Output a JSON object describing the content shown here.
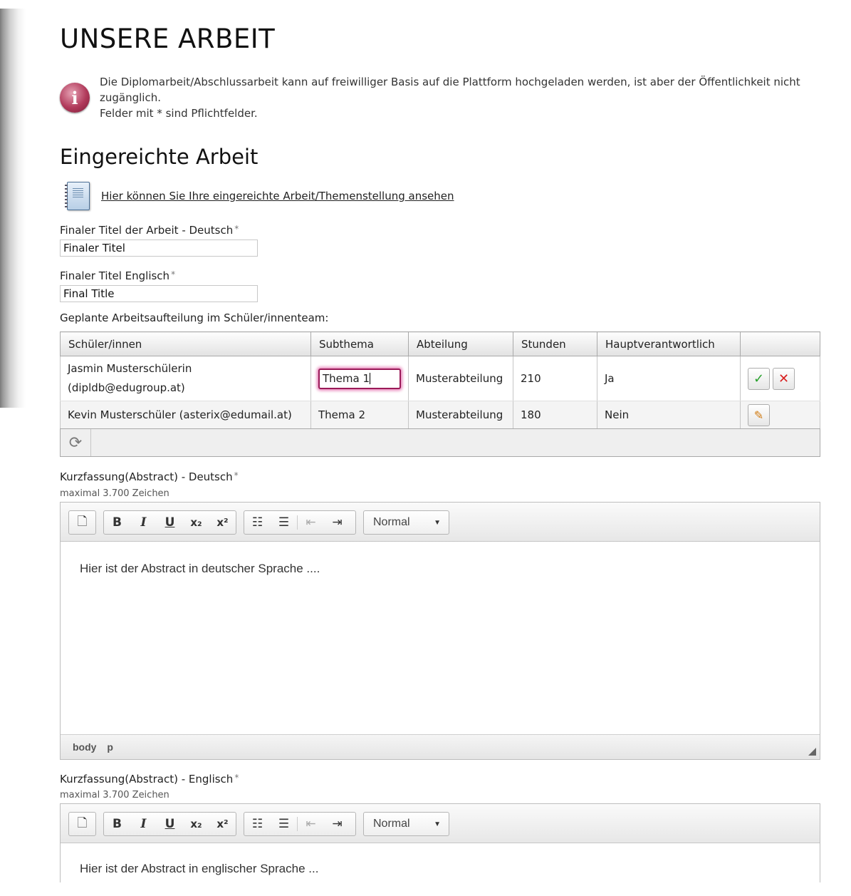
{
  "page": {
    "title": "UNSERE ARBEIT",
    "info_icon": "info-icon",
    "info_lines": [
      "Die Diplomarbeit/Abschlussarbeit kann auf freiwilliger Basis auf die Plattform hochgeladen werden, ist aber der Öffentlichkeit nicht zugänglich.",
      "Felder mit * sind Pflichtfelder."
    ]
  },
  "submitted": {
    "heading": "Eingereichte Arbeit",
    "doc_icon": "notebook-icon",
    "link_text": "Hier können Sie Ihre eingereichte Arbeit/Themenstellung ansehen"
  },
  "fields": {
    "title_de_label": "Finaler Titel der Arbeit - Deutsch",
    "title_de_value": "Finaler Titel",
    "title_en_label": "Finaler Titel Englisch",
    "title_en_value": "Final Title",
    "required_mark": "*"
  },
  "team": {
    "label": "Geplante Arbeitsaufteilung im Schüler/innenteam:",
    "columns": [
      "Schüler/innen",
      "Subthema",
      "Abteilung",
      "Stunden",
      "Hauptverantwortlich"
    ],
    "rows": [
      {
        "student_name": "Jasmin Musterschülerin",
        "student_email": "(dipldb@edugroup.at)",
        "subthema": "Thema 1",
        "abteilung": "Musterabteilung",
        "stunden": "210",
        "haupt": "Ja"
      },
      {
        "student": "Kevin Musterschüler (asterix@edumail.at)",
        "subthema": "Thema 2",
        "abteilung": "Musterabteilung",
        "stunden": "180",
        "haupt": "Nein"
      }
    ],
    "icons": {
      "ok": "checkmark-icon",
      "cancel": "close-icon",
      "edit": "pencil-icon",
      "refresh": "refresh-icon"
    }
  },
  "abstract_de": {
    "label": "Kurzfassung(Abstract) - Deutsch",
    "hint": "maximal 3.700 Zeichen",
    "content": "Hier ist der Abstract in deutscher Sprache ....",
    "format": "Normal",
    "status_path": [
      "body",
      "p"
    ]
  },
  "abstract_en": {
    "label": "Kurzfassung(Abstract) - Englisch",
    "hint": "maximal 3.700 Zeichen",
    "content": "Hier ist der Abstract in englischer Sprache ...",
    "format": "Normal"
  },
  "toolbar": {
    "preview": "preview-icon",
    "bold": "B",
    "italic": "I",
    "underline": "U",
    "subscript": "x₂",
    "superscript": "x²",
    "ordered_list": "ordered-list-icon",
    "bullet_list": "bullet-list-icon",
    "outdent": "outdent-icon",
    "indent": "indent-icon"
  }
}
